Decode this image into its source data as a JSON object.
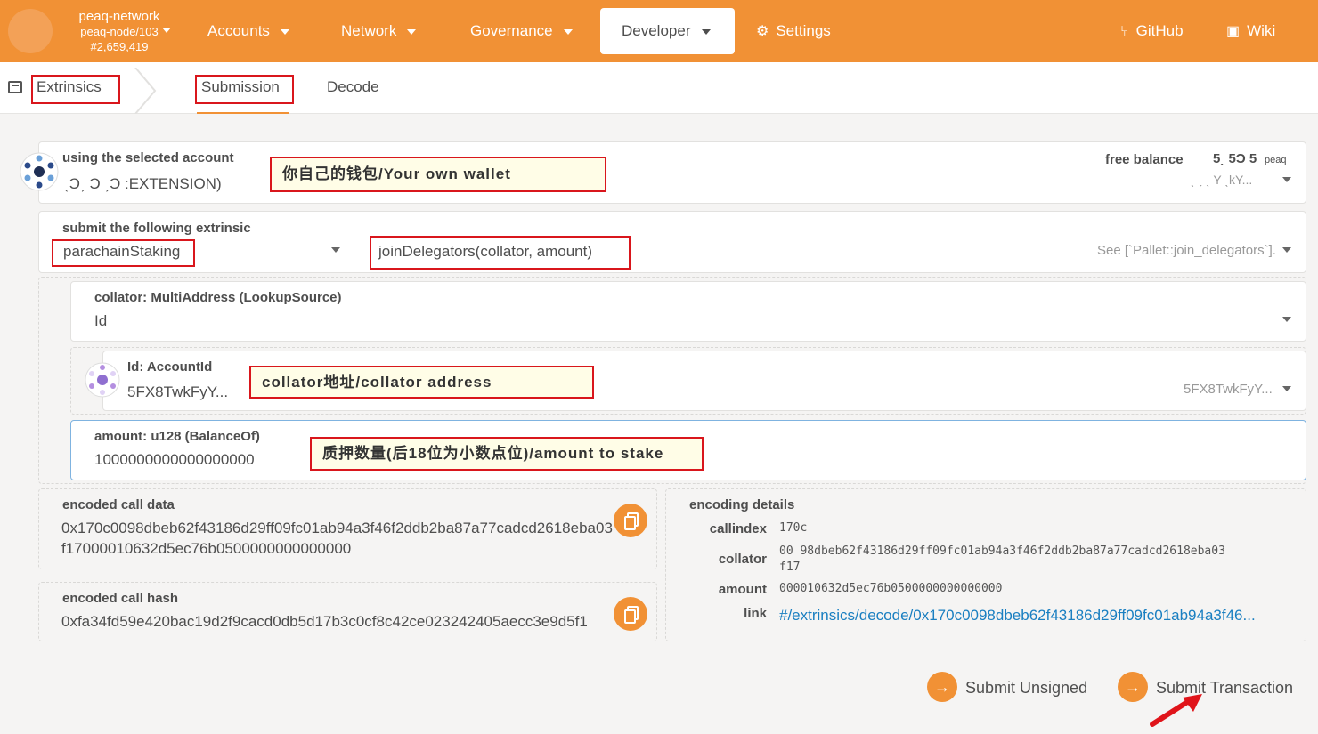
{
  "colors": {
    "accent": "#f19135",
    "annotation_border": "#d9161c",
    "annotation_bg": "#fffde7",
    "link": "#1a7fc1"
  },
  "node": {
    "name": "peaq-network",
    "node": "peaq-node/103",
    "block": "#2,659,419"
  },
  "nav": {
    "accounts": "Accounts",
    "network": "Network",
    "governance": "Governance",
    "developer": "Developer",
    "settings": "Settings",
    "github": "GitHub",
    "wiki": "Wiki"
  },
  "tabs": {
    "extrinsics": "Extrinsics",
    "submission": "Submission",
    "decode": "Decode"
  },
  "account": {
    "label": "using the selected account",
    "name": "ˎƆˏ Ɔ ˏƆ :EXTENSION)",
    "free_balance_label": "free balance",
    "free_balance_value": "5ˎ 5Ɔ 5",
    "free_balance_unit": "peaq",
    "address_short": "ˎ ˏ ˎ Y ˎkY...",
    "annotation": "你自己的钱包/Your own wallet"
  },
  "extrinsic": {
    "label": "submit the following extrinsic",
    "pallet": "parachainStaking",
    "method": "joinDelegators(collator, amount)",
    "doc": "See [`Pallet::join_delegators`]."
  },
  "collator": {
    "label": "collator: MultiAddress (LookupSource)",
    "value": "Id",
    "id_label": "Id: AccountId",
    "id_value": "5FX8TwkFyY...",
    "id_value_right": "5FX8TwkFyY...",
    "annotation": "collator地址/collator address"
  },
  "amount": {
    "label": "amount: u128 (BalanceOf)",
    "value": "1000000000000000000",
    "annotation": "质押数量(后18位为小数点位)/amount to stake"
  },
  "encoded_call_data": {
    "label": "encoded call data",
    "line1": "0x170c0098dbeb62f43186d29ff09fc01ab94a3f46f2ddb2ba87a77cadcd2618eba03",
    "line2": "f17000010632d5ec76b0500000000000000"
  },
  "encoded_call_hash": {
    "label": "encoded call hash",
    "value": "0xfa34fd59e420bac19d2f9cacd0db5d17b3c0cf8c42ce023242405aecc3e9d5f1"
  },
  "encoding_details": {
    "label": "encoding details",
    "callindex_label": "callindex",
    "callindex_value": "170c",
    "collator_label": "collator",
    "collator_value_1": "00 98dbeb62f43186d29ff09fc01ab94a3f46f2ddb2ba87a77cadcd2618eba03",
    "collator_value_2": "f17",
    "amount_label": "amount",
    "amount_value": "000010632d5ec76b0500000000000000",
    "link_label": "link",
    "link_value": "#/extrinsics/decode/0x170c0098dbeb62f43186d29ff09fc01ab94a3f46..."
  },
  "actions": {
    "submit_unsigned": "Submit Unsigned",
    "submit_transaction": "Submit Transaction"
  }
}
